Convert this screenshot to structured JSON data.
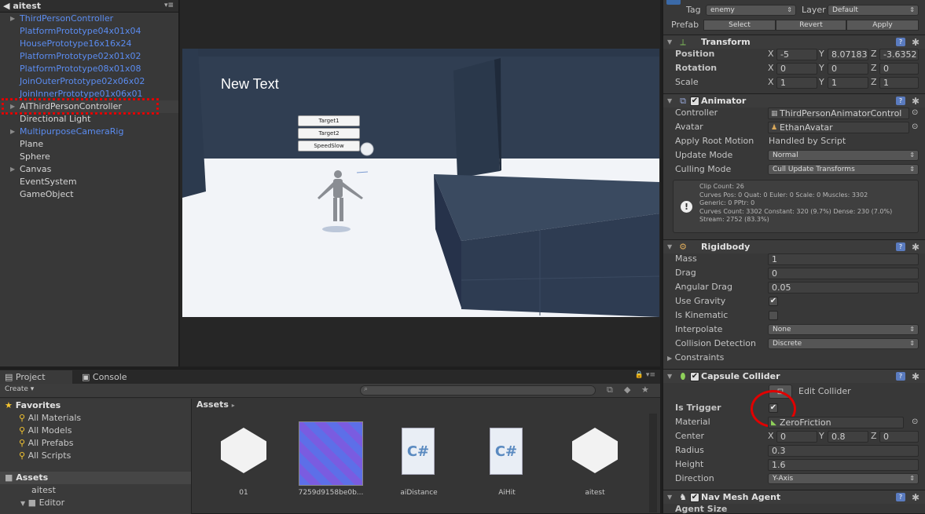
{
  "hierarchy": {
    "title": "aitest",
    "items": [
      {
        "label": "ThirdPersonController",
        "color": "blue",
        "arrow": true
      },
      {
        "label": "PlatformPrototype04x01x04",
        "color": "blue",
        "arrow": false
      },
      {
        "label": "HousePrototype16x16x24",
        "color": "blue",
        "arrow": false
      },
      {
        "label": "PlatformPrototype02x01x02",
        "color": "blue",
        "arrow": false
      },
      {
        "label": "PlatformPrototype08x01x08",
        "color": "blue",
        "arrow": false
      },
      {
        "label": "JoinOuterPrototype02x06x02",
        "color": "blue",
        "arrow": false
      },
      {
        "label": "JoinInnerPrototype01x06x01",
        "color": "blue",
        "arrow": false
      },
      {
        "label": "AIThirdPersonController",
        "color": "white",
        "arrow": true
      },
      {
        "label": "Directional Light",
        "color": "white",
        "arrow": false
      },
      {
        "label": "MultipurposeCameraRig",
        "color": "blue",
        "arrow": true
      },
      {
        "label": "Plane",
        "color": "white",
        "arrow": false
      },
      {
        "label": "Sphere",
        "color": "white",
        "arrow": false
      },
      {
        "label": "Canvas",
        "color": "white",
        "arrow": true
      },
      {
        "label": "EventSystem",
        "color": "white",
        "arrow": false
      },
      {
        "label": "GameObject",
        "color": "white",
        "arrow": false
      }
    ]
  },
  "scene": {
    "new_text": "New Text",
    "buttons": [
      "Target1",
      "Target2",
      "SpeedSlow"
    ]
  },
  "project": {
    "tabs": [
      "Project",
      "Console"
    ],
    "create": "Create",
    "breadcrumb": "Assets",
    "favorites_title": "Favorites",
    "favorites": [
      "All Materials",
      "All Models",
      "All Prefabs",
      "All Scripts"
    ],
    "assets_title": "Assets",
    "tree": [
      "aitest",
      "Editor"
    ],
    "assets": [
      "01",
      "7259d9158be0b...",
      "aiDistance",
      "AiHit",
      "aitest"
    ]
  },
  "inspector": {
    "tag_label": "Tag",
    "tag_value": "enemy",
    "layer_label": "Layer",
    "layer_value": "Default",
    "prefab_label": "Prefab",
    "prefab_buttons": [
      "Select",
      "Revert",
      "Apply"
    ],
    "transform": {
      "title": "Transform",
      "position_label": "Position",
      "position": [
        "-5",
        "8.07183",
        "-3.6352"
      ],
      "rotation_label": "Rotation",
      "rotation": [
        "0",
        "0",
        "0"
      ],
      "scale_label": "Scale",
      "scale": [
        "1",
        "1",
        "1"
      ]
    },
    "animator": {
      "title": "Animator",
      "controller_label": "Controller",
      "controller": "ThirdPersonAnimatorControl",
      "avatar_label": "Avatar",
      "avatar": "EthanAvatar",
      "root_motion_label": "Apply Root Motion",
      "root_motion": "Handled by Script",
      "update_mode_label": "Update Mode",
      "update_mode": "Normal",
      "culling_mode_label": "Culling Mode",
      "culling_mode": "Cull Update Transforms",
      "info": [
        "Clip Count: 26",
        "Curves Pos: 0 Quat: 0 Euler: 0 Scale: 0 Muscles: 3302",
        "Generic: 0 PPtr: 0",
        "Curves Count: 3302 Constant: 320 (9.7%) Dense: 230 (7.0%)",
        "Stream: 2752 (83.3%)"
      ]
    },
    "rigidbody": {
      "title": "Rigidbody",
      "mass_label": "Mass",
      "mass": "1",
      "drag_label": "Drag",
      "drag": "0",
      "angular_drag_label": "Angular Drag",
      "angular_drag": "0.05",
      "use_gravity_label": "Use Gravity",
      "is_kinematic_label": "Is Kinematic",
      "interpolate_label": "Interpolate",
      "interpolate": "None",
      "collision_label": "Collision Detection",
      "collision": "Discrete",
      "constraints_label": "Constraints"
    },
    "capsule": {
      "title": "Capsule Collider",
      "edit_label": "Edit Collider",
      "is_trigger_label": "Is Trigger",
      "material_label": "Material",
      "material": "ZeroFriction",
      "center_label": "Center",
      "center": [
        "0",
        "0.8",
        "0"
      ],
      "radius_label": "Radius",
      "radius": "0.3",
      "height_label": "Height",
      "height": "1.6",
      "direction_label": "Direction",
      "direction": "Y-Axis"
    },
    "navmesh": {
      "title": "Nav Mesh Agent",
      "agent_size_label": "Agent Size"
    },
    "axis": [
      "X",
      "Y",
      "Z"
    ]
  },
  "colors": {
    "highlight": "#e00000",
    "link_blue": "#5b8cf0"
  }
}
